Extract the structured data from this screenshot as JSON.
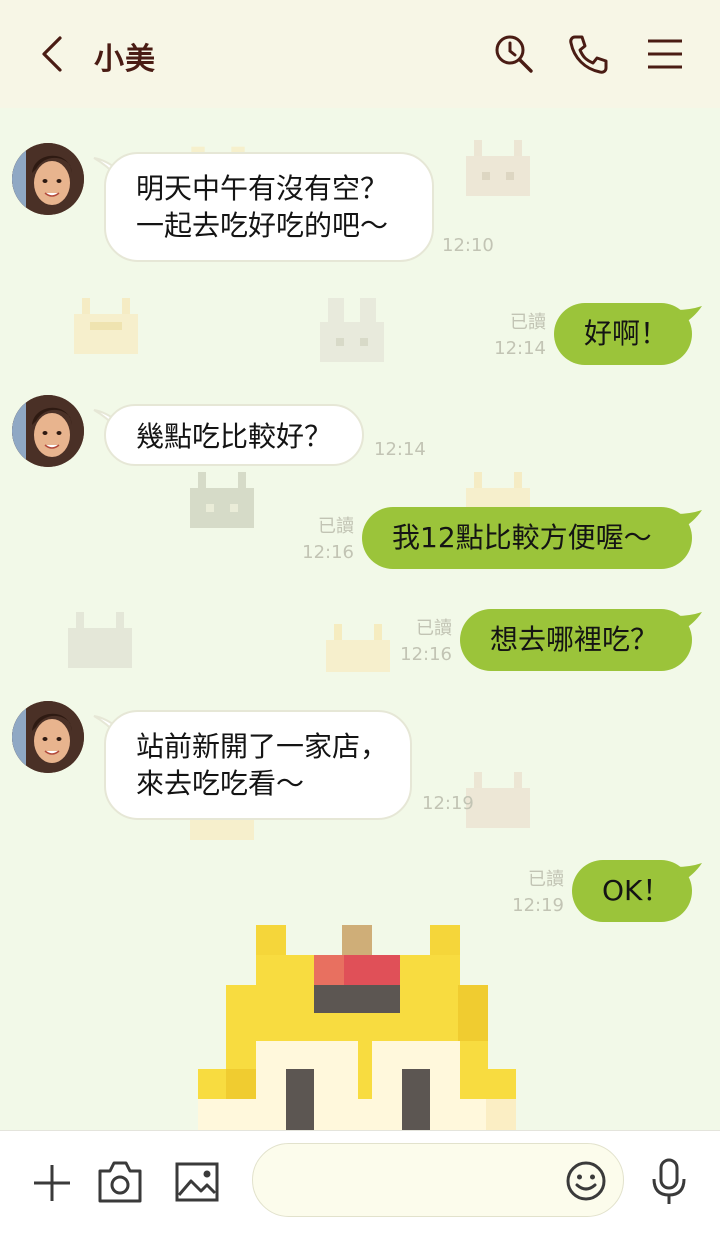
{
  "header": {
    "contact_name": "小美"
  },
  "messages": [
    {
      "direction": "in",
      "text": "明天中午有沒有空？\n一起去吃好吃的吧～",
      "time": "12:10"
    },
    {
      "direction": "out",
      "text": "好啊！",
      "read": "已讀",
      "time": "12:14"
    },
    {
      "direction": "in",
      "text": "幾點吃比較好？",
      "time": "12:14"
    },
    {
      "direction": "out",
      "text": "我12點比較方便喔～",
      "read": "已讀",
      "time": "12:16"
    },
    {
      "direction": "out",
      "text": "想去哪裡吃？",
      "read": "已讀",
      "time": "12:16"
    },
    {
      "direction": "in",
      "text": "站前新開了一家店，\n來去吃吃看～",
      "time": "12:19"
    },
    {
      "direction": "out",
      "text": "OK！",
      "read": "已讀",
      "time": "12:19"
    }
  ],
  "composer": {
    "placeholder": ""
  },
  "colors": {
    "header_bg": "#f7f6e6",
    "chat_bg": "#f2f9e8",
    "outgoing_bubble": "#9bc43a",
    "incoming_bubble": "#ffffff",
    "icon_color": "#4a1c14"
  },
  "icons": [
    "back-chevron-icon",
    "search-icon",
    "phone-icon",
    "menu-icon",
    "plus-icon",
    "camera-icon",
    "image-icon",
    "emoji-icon",
    "microphone-icon"
  ]
}
